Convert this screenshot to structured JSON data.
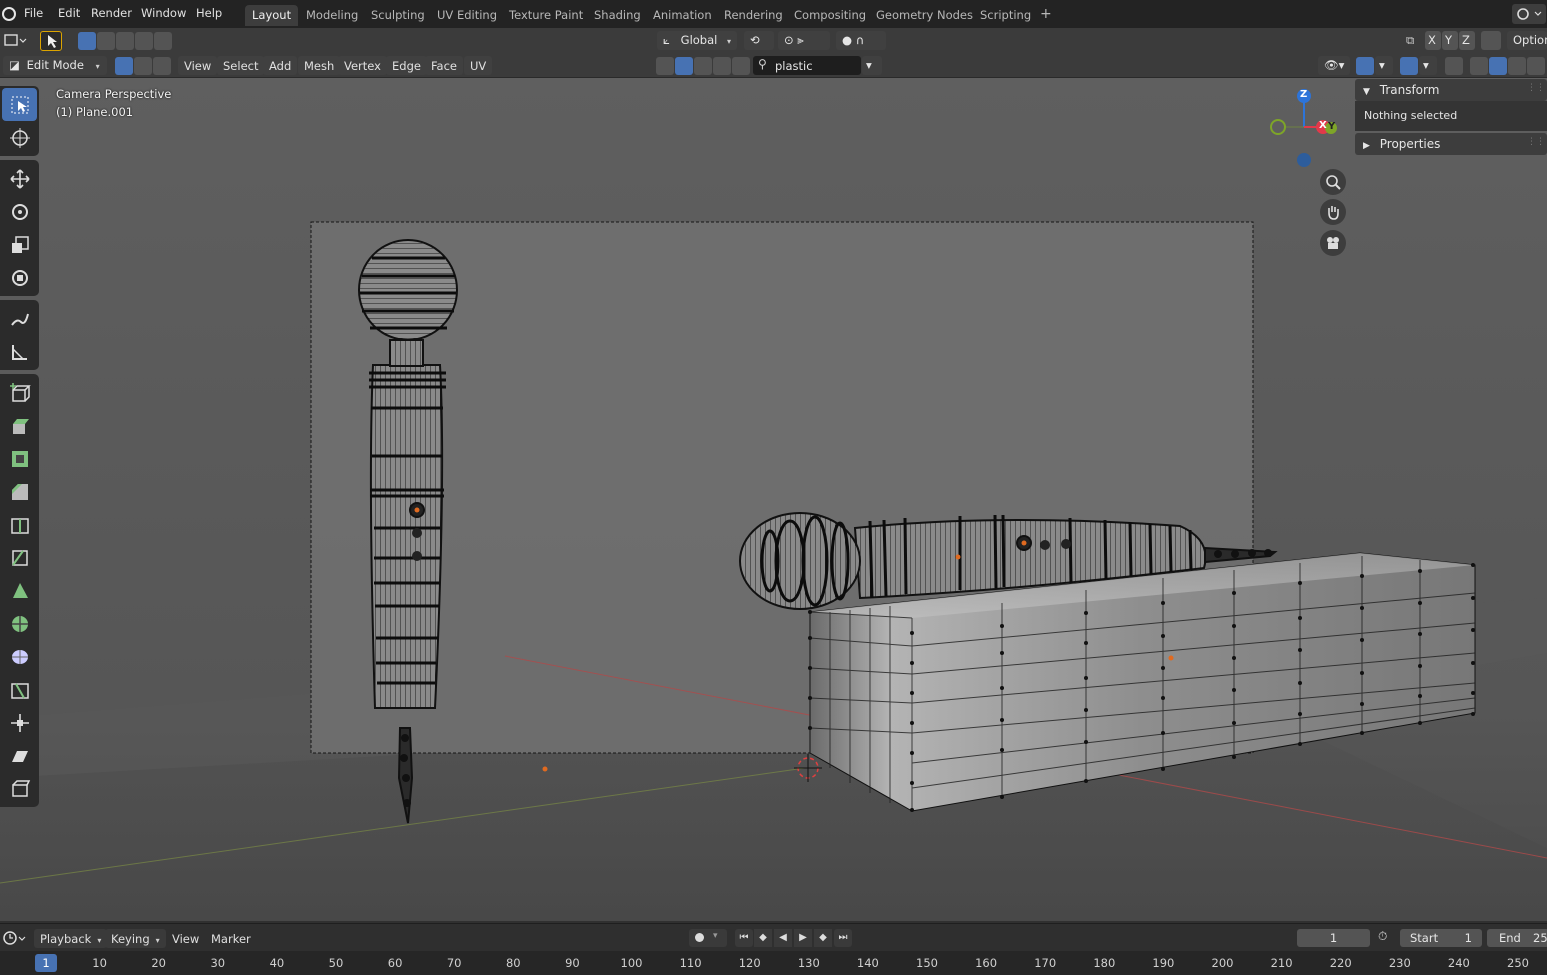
{
  "menubar": {
    "items": [
      "File",
      "Edit",
      "Render",
      "Window",
      "Help"
    ],
    "workspaces": [
      "Layout",
      "Modeling",
      "Sculpting",
      "UV Editing",
      "Texture Paint",
      "Shading",
      "Animation",
      "Rendering",
      "Compositing",
      "Geometry Nodes",
      "Scripting"
    ],
    "active_workspace": "Layout",
    "add_tab": "+"
  },
  "tool_header": {
    "orientation": "Global",
    "axis_x": "X",
    "axis_y": "Y",
    "axis_z": "Z",
    "options": "Option"
  },
  "mode_header": {
    "mode": "Edit Mode",
    "menus": [
      "View",
      "Select",
      "Add",
      "Mesh",
      "Vertex",
      "Edge",
      "Face",
      "UV"
    ],
    "material_name": "plastic"
  },
  "viewport": {
    "camera_label": "Camera Perspective",
    "object_label": "(1) Plane.001",
    "gizmo": {
      "z": "Z",
      "x": "X",
      "y": "Y"
    }
  },
  "npanel": {
    "transform_title": "Transform",
    "transform_body": "Nothing selected",
    "properties_title": "Properties"
  },
  "timeline": {
    "menus": [
      "Playback",
      "Keying",
      "View",
      "Marker"
    ],
    "current_frame": "1",
    "start_label": "Start",
    "start_value": "1",
    "end_label": "End",
    "end_value": "25",
    "ruler_current": "1",
    "ruler_ticks": [
      "10",
      "20",
      "30",
      "40",
      "50",
      "60",
      "70",
      "80",
      "90",
      "100",
      "110",
      "120",
      "130",
      "140",
      "150",
      "160",
      "170",
      "180",
      "190",
      "200",
      "210",
      "220",
      "230",
      "240",
      "250"
    ]
  },
  "colors": {
    "accent": "#4772b3",
    "axis_x": "#e2394a",
    "axis_y": "#7ea528",
    "axis_z": "#2d74d9"
  }
}
